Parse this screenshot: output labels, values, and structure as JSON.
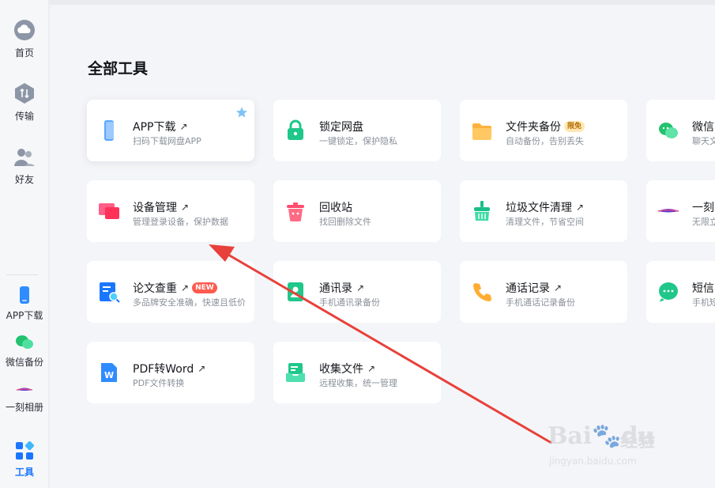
{
  "sidebar": {
    "top": [
      {
        "label": "首页",
        "icon": "cloud-icon"
      },
      {
        "label": "传输",
        "icon": "transfer-icon"
      },
      {
        "label": "好友",
        "icon": "friends-icon"
      }
    ],
    "bottom": [
      {
        "label": "APP下载",
        "icon": "phone-icon"
      },
      {
        "label": "微信备份",
        "icon": "wechat-icon"
      },
      {
        "label": "一刻相册",
        "icon": "album-icon"
      },
      {
        "label": "工具",
        "icon": "tools-icon",
        "active": true
      }
    ]
  },
  "page": {
    "title": "全部工具"
  },
  "cards": [
    {
      "title": "APP下载",
      "sub": "扫码下载网盘APP",
      "arrow": "↗"
    },
    {
      "title": "锁定网盘",
      "sub": "一键锁定，保护隐私"
    },
    {
      "title": "文件夹备份",
      "sub": "自动备份，告别丢失",
      "badge": "限免"
    },
    {
      "title": "微信",
      "sub": "聊天文"
    },
    {
      "title": "设备管理",
      "sub": "管理登录设备，保护数据",
      "arrow": "↗"
    },
    {
      "title": "回收站",
      "sub": "找回删除文件"
    },
    {
      "title": "垃圾文件清理",
      "sub": "清理文件，节省空间",
      "arrow": "↗"
    },
    {
      "title": "一刻",
      "sub": "无限立"
    },
    {
      "title": "论文查重",
      "sub": "多品牌安全准确，快速且低价",
      "arrow": "↗",
      "badge": "NEW"
    },
    {
      "title": "通讯录",
      "sub": "手机通讯录备份",
      "arrow": "↗"
    },
    {
      "title": "通话记录",
      "sub": "手机通话记录备份",
      "arrow": "↗"
    },
    {
      "title": "短信",
      "sub": "手机短"
    },
    {
      "title": "PDF转Word",
      "sub": "PDF文件转换",
      "arrow": "↗"
    },
    {
      "title": "收集文件",
      "sub": "远程收集，统一管理",
      "arrow": "↗"
    }
  ],
  "watermark": {
    "brand": "Bai",
    "brand2": "du",
    "cn": "经验",
    "url": "jingyan.baidu.com"
  },
  "colors": {
    "accent": "#1a76ff",
    "arrow": "#e8403a"
  }
}
